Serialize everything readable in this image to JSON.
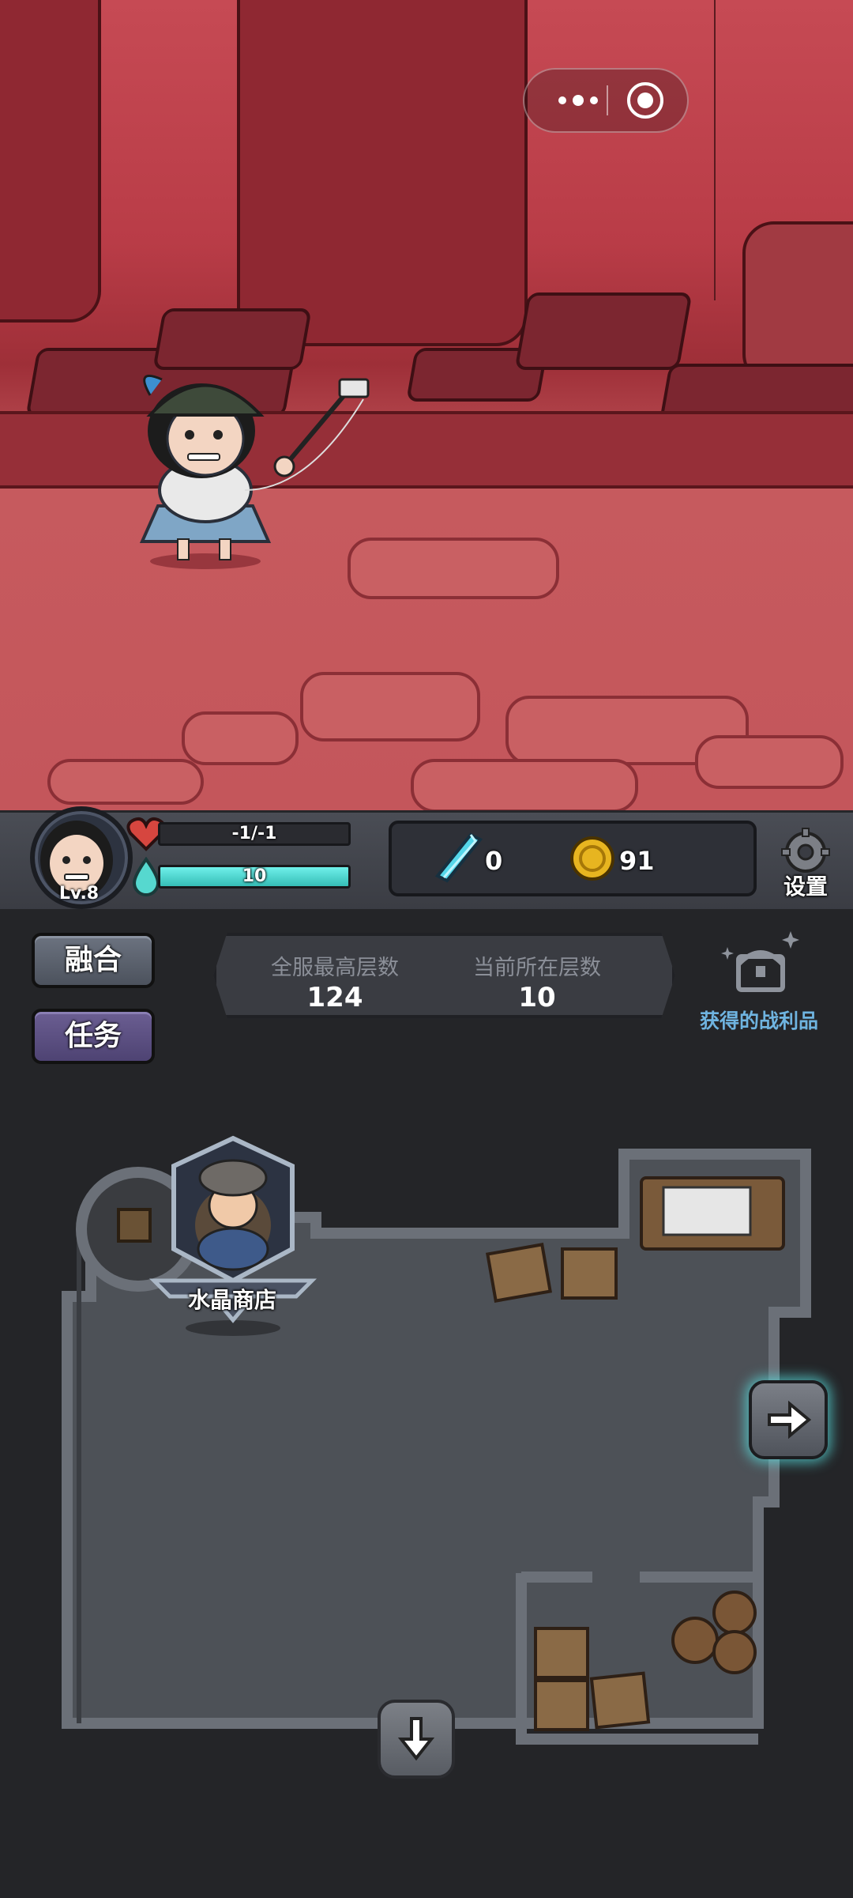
{
  "hud": {
    "level": "Lv.8",
    "hp_text": "-1/-1",
    "mp_text": "10",
    "mp_fill": 1.0,
    "crystals": "0",
    "coins": "91",
    "settings_label": "设置"
  },
  "side": {
    "fuse_label": "融合",
    "quest_label": "任务"
  },
  "floors": {
    "server_best_label": "全服最高层数",
    "server_best_value": "124",
    "current_label": "当前所在层数",
    "current_value": "10"
  },
  "loot": {
    "label": "获得的战利品"
  },
  "map": {
    "shop_label": "水晶商店"
  },
  "icons": {
    "heart": "heart-icon",
    "mana": "mana-drop-icon",
    "crystal": "crystal-icon",
    "coin": "coin-icon",
    "settings": "gear-icon",
    "loot": "treasure-chest-icon",
    "next": "arrow-right-icon",
    "down": "arrow-down-icon"
  },
  "colors": {
    "mana_bar": "#35bdb6",
    "loot_text": "#6fb4e0",
    "quest_button": "#4e4373",
    "fuse_button": "#4c525d",
    "scene_red": "#b93c47"
  }
}
